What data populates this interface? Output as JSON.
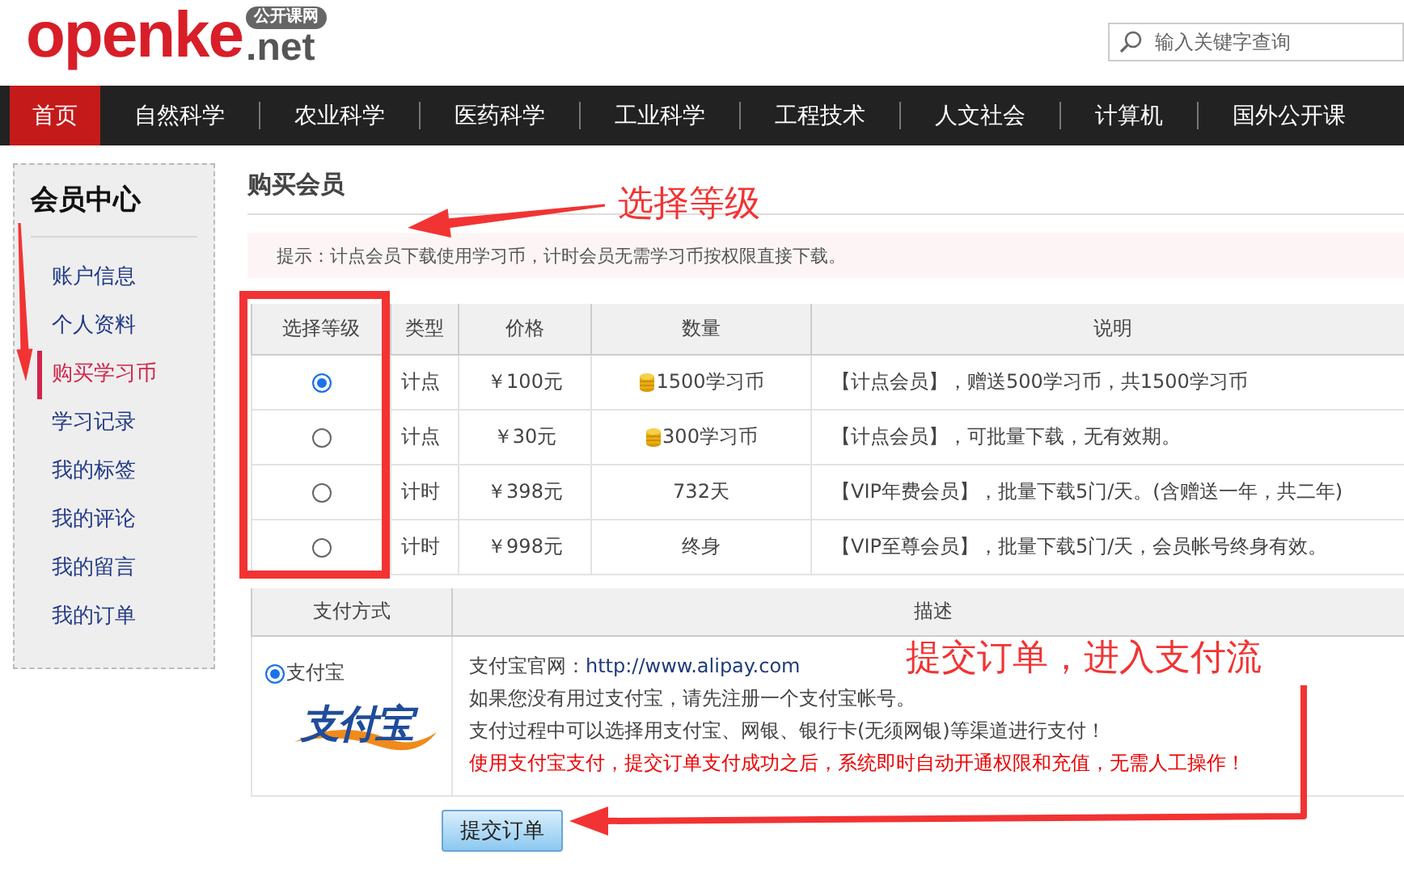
{
  "logo": {
    "name": "openke",
    "domain": ".net",
    "badge": "公开课网"
  },
  "search": {
    "placeholder": "输入关键字查询"
  },
  "nav": [
    {
      "label": "首页",
      "selected": true
    },
    {
      "label": "自然科学",
      "selected": false
    },
    {
      "label": "农业科学",
      "selected": false
    },
    {
      "label": "医药科学",
      "selected": false
    },
    {
      "label": "工业科学",
      "selected": false
    },
    {
      "label": "工程技术",
      "selected": false
    },
    {
      "label": "人文社会",
      "selected": false
    },
    {
      "label": "计算机",
      "selected": false
    },
    {
      "label": "国外公开课",
      "selected": false
    }
  ],
  "sidebar": {
    "title": "会员中心",
    "items": [
      {
        "label": "账户信息",
        "selected": false
      },
      {
        "label": "个人资料",
        "selected": false
      },
      {
        "label": "购买学习币",
        "selected": true
      },
      {
        "label": "学习记录",
        "selected": false
      },
      {
        "label": "我的标签",
        "selected": false
      },
      {
        "label": "我的评论",
        "selected": false
      },
      {
        "label": "我的留言",
        "selected": false
      },
      {
        "label": "我的订单",
        "selected": false
      }
    ]
  },
  "main": {
    "title": "购买会员",
    "hint": "提示：计点会员下载使用学习币，计时会员无需学习币按权限直接下载。",
    "plans": {
      "columns": [
        "选择等级",
        "类型",
        "价格",
        "数量",
        "说明"
      ],
      "rows": [
        {
          "selected": true,
          "type": "计点",
          "price": "￥100元",
          "quantity": "1500学习币",
          "coin": true,
          "note": "【计点会员】，赠送500学习币，共1500学习币"
        },
        {
          "selected": false,
          "type": "计点",
          "price": "￥30元",
          "quantity": "300学习币",
          "coin": true,
          "note": "【计点会员】，可批量下载，无有效期。"
        },
        {
          "selected": false,
          "type": "计时",
          "price": "￥398元",
          "quantity": "732天",
          "coin": false,
          "note": "【VIP年费会员】，批量下载5门/天。(含赠送一年，共二年)"
        },
        {
          "selected": false,
          "type": "计时",
          "price": "￥998元",
          "quantity": "终身",
          "coin": false,
          "note": "【VIP至尊会员】，批量下载5门/天，会员帐号终身有效。"
        }
      ]
    },
    "payment": {
      "columns": [
        "支付方式",
        "描述"
      ],
      "methods": [
        {
          "selected": true,
          "label": "支付宝",
          "logo": "支付宝",
          "lines": [
            {
              "kind": "plain",
              "text": "支付宝官网：",
              "link": "http://www.alipay.com"
            },
            {
              "kind": "plain",
              "text": "如果您没有用过支付宝，请先注册一个支付宝帐号。"
            },
            {
              "kind": "plain",
              "text": "支付过程中可以选择用支付宝、网银、银行卡(无须网银)等渠道进行支付！"
            },
            {
              "kind": "warning",
              "text": "使用支付宝支付，提交订单支付成功之后，系统即时自动开通权限和充值，无需人工操作！"
            }
          ]
        }
      ]
    },
    "submit": "提交订单"
  },
  "annotations": [
    {
      "kind": "label",
      "text": "选择等级"
    },
    {
      "kind": "label",
      "text": "提交订单，进入支付流"
    }
  ]
}
